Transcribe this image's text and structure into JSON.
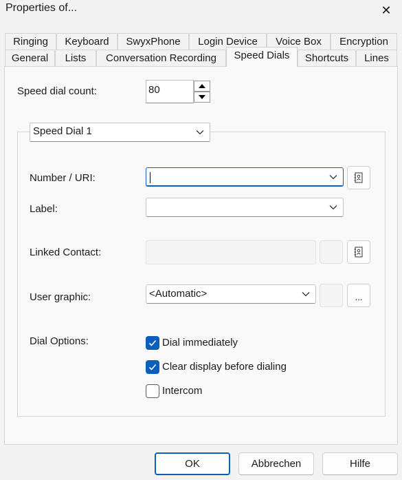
{
  "window": {
    "title": "Properties of...",
    "close_glyph": "✕"
  },
  "tabs": {
    "row1": [
      "Ringing",
      "Keyboard",
      "SwyxPhone",
      "Login Device",
      "Voice Box",
      "Encryption"
    ],
    "row2": [
      "General",
      "Lists",
      "Conversation Recording",
      "Speed Dials",
      "Shortcuts",
      "Lines"
    ],
    "active": "Speed Dials"
  },
  "speed_dial_count": {
    "label": "Speed dial count:",
    "value": "80"
  },
  "speed_dial_select": {
    "value": "Speed Dial 1"
  },
  "number": {
    "label": "Number / URI:",
    "value": ""
  },
  "label_field": {
    "label": "Label:",
    "value": ""
  },
  "linked_contact": {
    "label": "Linked Contact:",
    "value": ""
  },
  "user_graphic": {
    "label": "User graphic:",
    "value": "<Automatic>",
    "browse_label": "..."
  },
  "dial_options": {
    "label": "Dial Options:",
    "dial_immediately": {
      "label": "Dial immediately",
      "checked": true
    },
    "clear_display": {
      "label": "Clear display before dialing",
      "checked": true
    },
    "intercom": {
      "label": "Intercom",
      "checked": false
    }
  },
  "buttons": {
    "ok": "OK",
    "cancel": "Abbrechen",
    "help": "Hilfe"
  },
  "colors": {
    "accent": "#0a5fbd",
    "background": "#f3f3f3",
    "panel": "#f9f9f9"
  }
}
